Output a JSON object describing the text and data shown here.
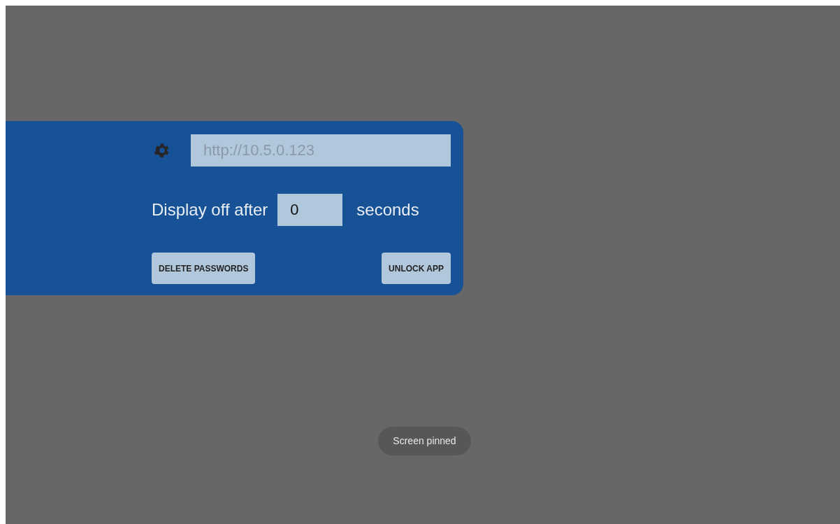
{
  "settings_panel": {
    "server_field": {
      "placeholder": "http://10.5.0.123"
    },
    "display_off": {
      "label": "Display off after",
      "value": "0",
      "unit": "seconds"
    },
    "buttons": [
      "DELETE PASSWORDS",
      "UNLOCK APP"
    ]
  },
  "toast": "Screen pinned"
}
